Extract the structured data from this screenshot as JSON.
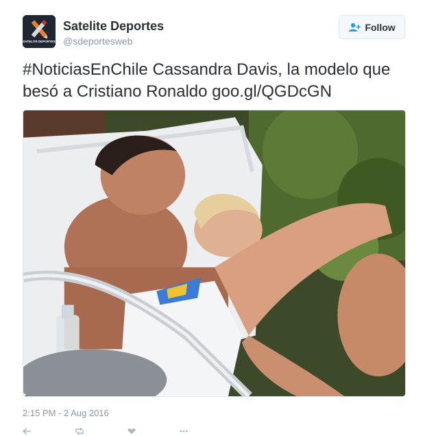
{
  "account": {
    "name": "Satelite Deportes",
    "handle": "@sdeportesweb",
    "avatar_text": "SATELITE DEPORTES"
  },
  "follow_button": {
    "label": "Follow",
    "icon": "add-user-icon"
  },
  "tweet": {
    "hashtag": "#NoticiasEnChile",
    "text": "Cassandra Davis, la modelo que besó a Cristiano Ronaldo",
    "link": "goo.gl/QGDcGN",
    "timestamp": "2:15 PM - 2 Aug 2016"
  },
  "actions": [
    "reply-icon",
    "retweet-icon",
    "like-icon",
    "more-icon"
  ],
  "colors": {
    "text": "#292f33",
    "muted": "#8899a6",
    "button_bg": "#f5f8fa",
    "border": "#e1e8ed",
    "follow_icon": "#1da1f2"
  }
}
